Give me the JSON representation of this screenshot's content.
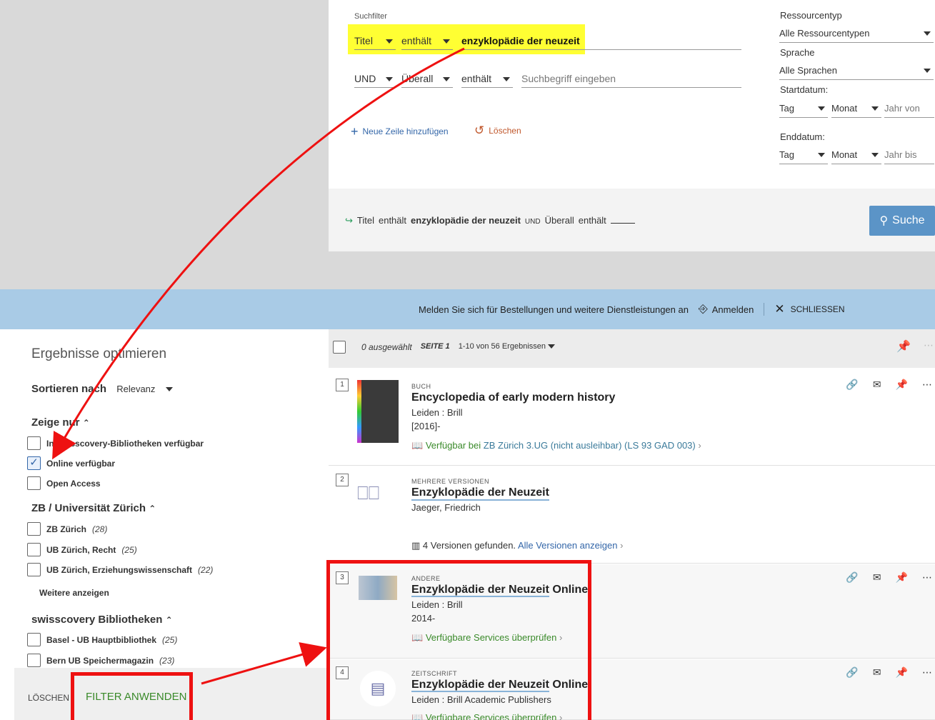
{
  "search": {
    "section_label": "Suchfilter",
    "row1": {
      "field": "Titel",
      "operator": "enthält",
      "value": "enzyklopädie der neuzeit"
    },
    "row2": {
      "boolean": "UND",
      "field": "Überall",
      "operator": "enthält",
      "placeholder": "Suchbegriff eingeben"
    },
    "add_row": "Neue Zeile hinzufügen",
    "clear": "Löschen",
    "summary": {
      "field1": "Titel",
      "op1": "enthält",
      "val1": "enzyklopädie der neuzeit",
      "bool": "UND",
      "field2": "Überall",
      "op2": "enthält"
    },
    "submit": "Suche"
  },
  "filters": {
    "resource_type_label": "Ressourcentyp",
    "resource_type_value": "Alle Ressourcentypen",
    "language_label": "Sprache",
    "language_value": "Alle Sprachen",
    "start_label": "Startdatum:",
    "end_label": "Enddatum:",
    "day": "Tag",
    "month": "Monat",
    "year_from": "Jahr von",
    "year_to": "Jahr bis"
  },
  "banner": {
    "text": "Melden Sie sich für Bestellungen und weitere Dienstleistungen an",
    "login": "Anmelden",
    "close": "SCHLIESSEN"
  },
  "results_header": {
    "selected": "0 ausgewählt",
    "page": "SEITE 1",
    "range": "1-10 von 56 Ergebnissen"
  },
  "results": [
    {
      "num": "1",
      "type": "BUCH",
      "title": "Encyclopedia of early modern history",
      "line1": "Leiden : Brill",
      "line2": "[2016]-",
      "avail_prefix": "Verfügbar bei",
      "avail_link": "ZB Zürich  3.UG (nicht ausleihbar) (LS 93 GAD 003)"
    },
    {
      "num": "2",
      "type": "MEHRERE VERSIONEN",
      "title": "Enzyklopädie der Neuzeit",
      "line1": "Jaeger, Friedrich",
      "versions_text": "4 Versionen gefunden.",
      "versions_link": "Alle Versionen anzeigen"
    },
    {
      "num": "3",
      "type": "ANDERE",
      "title_a": "Enzyklopädie der Neuzeit",
      "title_b": " Online",
      "line1": "Leiden : Brill",
      "line2": "2014-",
      "avail": "Verfügbare Services überprüfen"
    },
    {
      "num": "4",
      "type": "ZEITSCHRIFT",
      "title_a": "Enzyklopädie der Neuzeit",
      "title_b": " Online",
      "line1": "Leiden : Brill Academic Publishers",
      "avail": "Verfügbare Services überprüfen"
    }
  ],
  "sidebar": {
    "heading": "Ergebnisse optimieren",
    "sort_label": "Sortieren nach",
    "sort_value": "Relevanz",
    "show_only": "Zeige nur",
    "show_items": [
      {
        "label": "In swisscovery-Bibliotheken verfügbar",
        "checked": false
      },
      {
        "label": "Online verfügbar",
        "checked": true
      },
      {
        "label": "Open Access",
        "checked": false
      }
    ],
    "uzh_heading": "ZB / Universität Zürich",
    "uzh_items": [
      {
        "label": "ZB Zürich",
        "count": "(28)"
      },
      {
        "label": "UB Zürich, Recht",
        "count": "(25)"
      },
      {
        "label": "UB Zürich, Erziehungswissenschaft",
        "count": "(22)"
      }
    ],
    "more": "Weitere anzeigen",
    "sc_heading": "swisscovery Bibliotheken",
    "sc_items": [
      {
        "label": "Basel - UB Hauptbibliothek",
        "count": "(25)"
      },
      {
        "label": "Bern UB Speichermagazin",
        "count": "(23)"
      }
    ],
    "clear": "LÖSCHEN",
    "apply": "FILTER ANWENDEN"
  },
  "colors": {
    "accent": "#5b94c7",
    "highlight": "#ffff33",
    "annotation": "#ee1111",
    "available": "#3a8a2a"
  }
}
